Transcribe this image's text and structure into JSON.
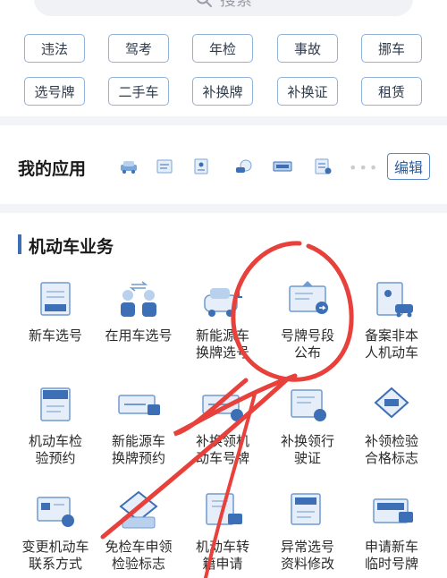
{
  "search": {
    "placeholder": "搜索",
    "icon": "search-icon"
  },
  "quick_tags": [
    "违法",
    "驾考",
    "年检",
    "事故",
    "挪车",
    "选号牌",
    "二手车",
    "补换牌",
    "补换证",
    "租赁"
  ],
  "my_apps": {
    "title": "我的应用",
    "icons": [
      "car-icon",
      "document-icon",
      "license-icon",
      "driver-icon",
      "plate-icon",
      "form-icon"
    ],
    "more": "•••",
    "edit_label": "编辑"
  },
  "section": {
    "title": "机动车业务",
    "items": [
      {
        "label": "新车选号",
        "icon": "plate-board-icon"
      },
      {
        "label": "在用车选号",
        "icon": "people-swap-icon"
      },
      {
        "label": "新能源车\n换牌选号",
        "icon": "ev-car-icon"
      },
      {
        "label": "号牌号段\n公布",
        "icon": "announcement-icon"
      },
      {
        "label": "备案非本\n人机动车",
        "icon": "record-car-icon"
      },
      {
        "label": "机动车检\n验预约",
        "icon": "inspection-booking-icon",
        "badge": "检"
      },
      {
        "label": "新能源车\n换牌预约",
        "icon": "ev-plate-booking-icon",
        "badge": "预"
      },
      {
        "label": "补换领机\n动车号牌",
        "icon": "plate-replace-icon",
        "badge": "补"
      },
      {
        "label": "补换领行\n驶证",
        "icon": "license-replace-icon"
      },
      {
        "label": "补领检验\n合格标志",
        "icon": "inspection-mark-icon",
        "badge": "检"
      },
      {
        "label": "变更机动车\n联系方式",
        "icon": "contact-change-icon"
      },
      {
        "label": "免检车申领\n检验标志",
        "icon": "exempt-mark-icon",
        "badge": "免检"
      },
      {
        "label": "机动车转\n籍申请",
        "icon": "transfer-icon",
        "badge": "转"
      },
      {
        "label": "异常选号\n资料修改",
        "icon": "abnormal-edit-icon"
      },
      {
        "label": "申请新车\n临时号牌",
        "icon": "temp-plate-icon",
        "badge": "临"
      }
    ]
  },
  "colors": {
    "accent": "#3c6fb5",
    "tag_border": "#8fb2d8",
    "annotation": "#e8403a"
  }
}
